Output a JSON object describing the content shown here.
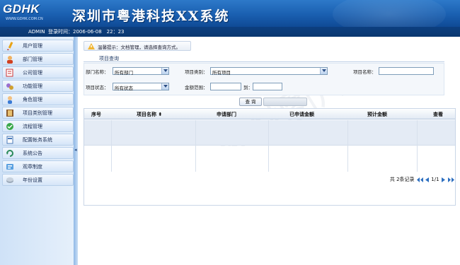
{
  "header": {
    "logo_text": "GDHK",
    "logo_url": "WWW.GDHK.COM.CN",
    "system_title": "深圳市粤港科技XX系统"
  },
  "infobar": {
    "user": "ADMIN",
    "login_time": "登录时间：2006-06-08　22：23"
  },
  "sidebar": {
    "items": [
      {
        "label": "用户管理",
        "icon": "pencil-icon"
      },
      {
        "label": "部门管理",
        "icon": "user-icon"
      },
      {
        "label": "公司管理",
        "icon": "note-icon"
      },
      {
        "label": "功能管理",
        "icon": "gears-icon"
      },
      {
        "label": "角色管理",
        "icon": "person-icon"
      },
      {
        "label": "项目类别管理",
        "icon": "book-icon"
      },
      {
        "label": "流程管理",
        "icon": "check-icon"
      },
      {
        "label": "配置帐务系统",
        "icon": "document-icon"
      },
      {
        "label": "系统公告",
        "icon": "refresh-icon"
      },
      {
        "label": "观章制度",
        "icon": "info-icon"
      },
      {
        "label": "年份设置",
        "icon": "disk-icon"
      }
    ]
  },
  "main": {
    "hint": "温馨提示：文档管理，请选择查询方式。",
    "panel_title": "项目查询",
    "form": {
      "dept_label": "部门名称：",
      "dept_value": "所有部门",
      "category_label": "项目类别：",
      "category_value": "所有项目",
      "name_label": "项目名称：",
      "name_value": "",
      "status_label": "项目状态：",
      "status_value": "所有状态",
      "amount_label": "金额范围：",
      "amount_from": "",
      "to_label": "到：",
      "amount_to": ""
    },
    "query_button": "查 询",
    "table": {
      "columns": [
        "序号",
        "项目名称",
        "申请部门",
        "已申请金额",
        "预计金额",
        "查看"
      ],
      "sort_icon": "sort-icon",
      "rows": []
    },
    "pager": {
      "total_text": "共 2条记录",
      "page_text": "1/1"
    }
  },
  "colors": {
    "header_blue": "#1a5fb0",
    "infobar_dark": "#0c3f80",
    "sidebar_bg": "#d5e5f8",
    "row_alt": "#e4ebf5"
  }
}
